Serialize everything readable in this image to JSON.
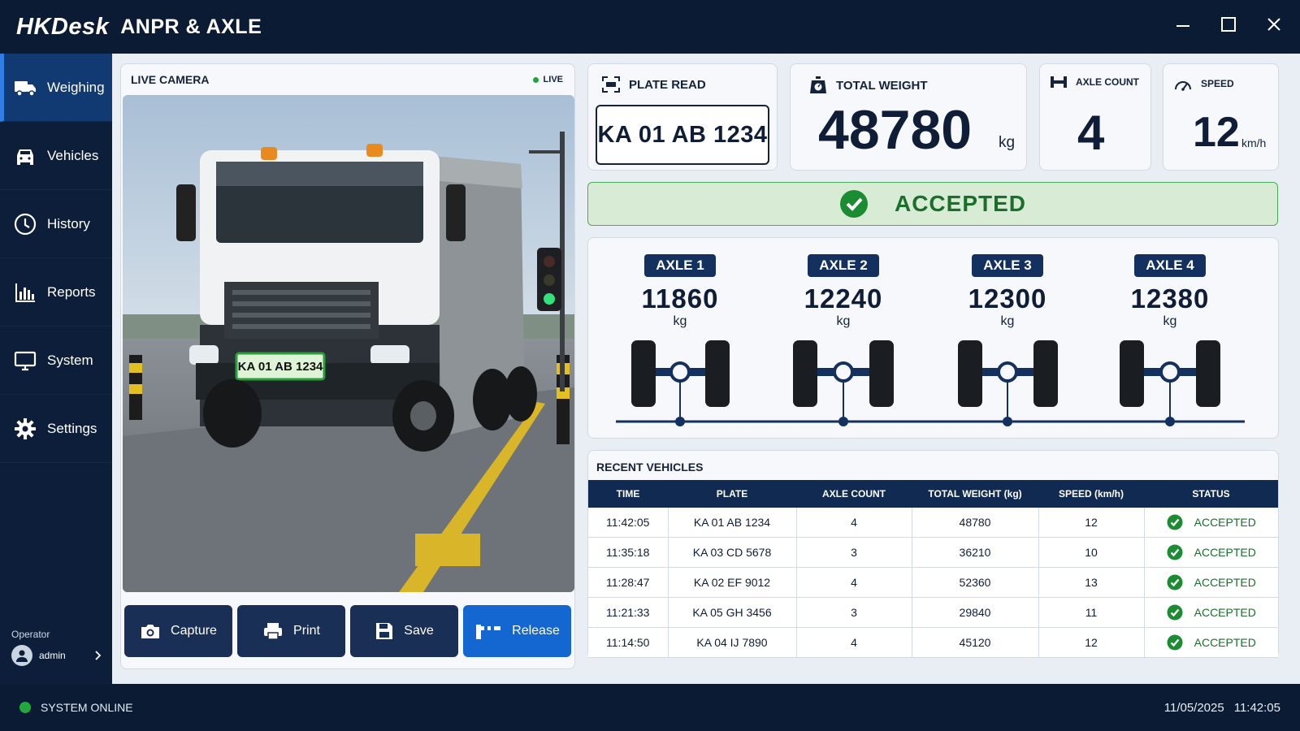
{
  "app": {
    "brand": "HKDesk",
    "subtitle": "ANPR & AXLE"
  },
  "sidebar": {
    "items": [
      {
        "label": "Weighing",
        "icon": "truck-icon",
        "active": true
      },
      {
        "label": "Vehicles",
        "icon": "car-icon",
        "active": false
      },
      {
        "label": "History",
        "icon": "clock-icon",
        "active": false
      },
      {
        "label": "Reports",
        "icon": "bar-chart-icon",
        "active": false
      },
      {
        "label": "System",
        "icon": "monitor-icon",
        "active": false
      },
      {
        "label": "Settings",
        "icon": "gear-icon",
        "active": false
      }
    ],
    "operator_label": "Operator",
    "operator_name": "admin"
  },
  "camera": {
    "title": "LIVE CAMERA",
    "live_label": "LIVE",
    "plate_overlay": "KA 01 AB 1234"
  },
  "actions": {
    "capture": "Capture",
    "print": "Print",
    "save": "Save",
    "release": "Release"
  },
  "plate": {
    "title": "PLATE READ",
    "value": "KA 01 AB 1234"
  },
  "weight": {
    "title": "TOTAL WEIGHT",
    "value": "48780",
    "unit": "kg"
  },
  "axle_count": {
    "title": "AXLE COUNT",
    "value": "4"
  },
  "speed": {
    "title": "SPEED",
    "value": "12",
    "unit": "km/h"
  },
  "status_banner": {
    "label": "ACCEPTED"
  },
  "axles": [
    {
      "label": "AXLE 1",
      "weight": "11860",
      "unit": "kg"
    },
    {
      "label": "AXLE 2",
      "weight": "12240",
      "unit": "kg"
    },
    {
      "label": "AXLE 3",
      "weight": "12300",
      "unit": "kg"
    },
    {
      "label": "AXLE 4",
      "weight": "12380",
      "unit": "kg"
    }
  ],
  "recent": {
    "title": "RECENT VEHICLES",
    "columns": [
      "TIME",
      "PLATE",
      "AXLE COUNT",
      "TOTAL WEIGHT (kg)",
      "SPEED (km/h)",
      "STATUS"
    ],
    "rows": [
      [
        "11:42:05",
        "KA 01 AB 1234",
        "4",
        "48780",
        "12",
        "ACCEPTED"
      ],
      [
        "11:35:18",
        "KA 03 CD 5678",
        "3",
        "36210",
        "10",
        "ACCEPTED"
      ],
      [
        "11:28:47",
        "KA 02 EF 9012",
        "4",
        "52360",
        "13",
        "ACCEPTED"
      ],
      [
        "11:21:33",
        "KA 05 GH 3456",
        "3",
        "29840",
        "11",
        "ACCEPTED"
      ],
      [
        "11:14:50",
        "KA 04 IJ 7890",
        "4",
        "45120",
        "12",
        "ACCEPTED"
      ]
    ]
  },
  "statusbar": {
    "system": "SYSTEM ONLINE",
    "date": "11/05/2025",
    "time": "11:42:05"
  },
  "colors": {
    "accent": "#1466d0",
    "navy": "#0b1b33",
    "success": "#1fa33a",
    "banner_bg": "#d8ecd5"
  }
}
